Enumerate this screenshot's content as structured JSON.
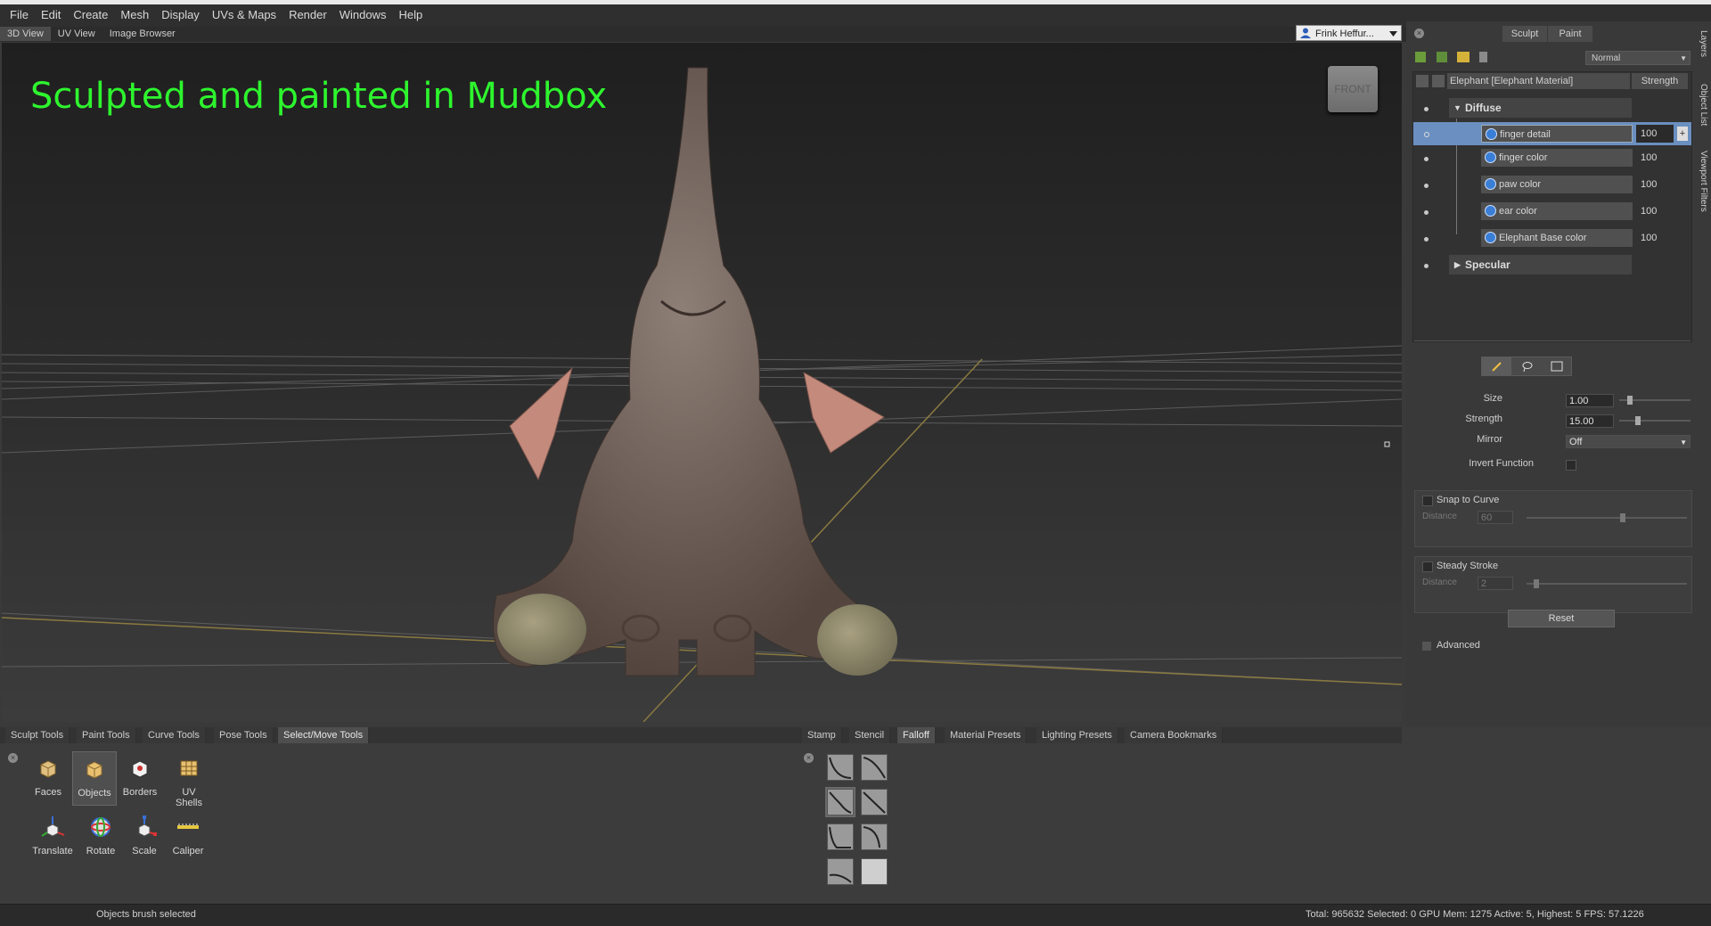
{
  "menu": [
    "File",
    "Edit",
    "Create",
    "Mesh",
    "Display",
    "UVs & Maps",
    "Render",
    "Windows",
    "Help"
  ],
  "view_tabs": [
    "3D View",
    "UV View",
    "Image Browser"
  ],
  "user": {
    "name": "Frink Heffur..."
  },
  "viewport": {
    "title": "Sculpted and painted in Mudbox",
    "viewcube_label": "FRONT"
  },
  "right_panel": {
    "side_tabs": [
      "Layers",
      "Object List",
      "Viewport Filters"
    ],
    "mode_tabs": [
      "Sculpt",
      "Paint"
    ],
    "blend_mode": "Normal",
    "layer_header": {
      "name": "Elephant [Elephant Material]",
      "strength": "Strength"
    },
    "groups": {
      "diffuse": "Diffuse",
      "specular": "Specular"
    },
    "layers": [
      {
        "name": "finger detail",
        "value": "100"
      },
      {
        "name": "finger color",
        "value": "100"
      },
      {
        "name": "paw color",
        "value": "100"
      },
      {
        "name": "ear color",
        "value": "100"
      },
      {
        "name": "Elephant Base color",
        "value": "100"
      }
    ],
    "brush": {
      "size_label": "Size",
      "size": "1.00",
      "strength_label": "Strength",
      "strength": "15.00",
      "mirror_label": "Mirror",
      "mirror": "Off",
      "invert_label": "Invert Function",
      "snap_label": "Snap to Curve",
      "snap_distance_label": "Distance",
      "snap_distance": "60",
      "steady_label": "Steady Stroke",
      "steady_distance_label": "Distance",
      "steady_distance": "2",
      "reset": "Reset",
      "advanced": "Advanced"
    }
  },
  "tray": {
    "left_tabs": [
      "Sculpt Tools",
      "Paint Tools",
      "Curve Tools",
      "Pose Tools",
      "Select/Move Tools"
    ],
    "right_tabs": [
      "Stamp",
      "Stencil",
      "Falloff",
      "Material Presets",
      "Lighting Presets",
      "Camera Bookmarks"
    ],
    "tools_row1": [
      "Faces",
      "Objects",
      "Borders",
      "UV Shells"
    ],
    "tools_row2": [
      "Translate",
      "Rotate",
      "Scale",
      "Caliper"
    ]
  },
  "status": {
    "left": "Objects brush selected",
    "right": "Total: 965632  Selected: 0 GPU Mem: 1275  Active: 5, Highest: 5  FPS: 57.1226"
  }
}
